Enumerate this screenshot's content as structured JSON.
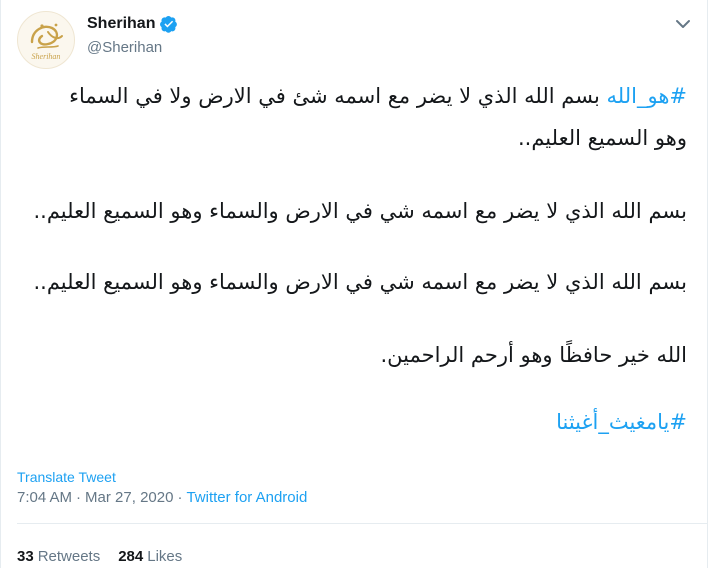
{
  "author": {
    "display_name": "Sherihan",
    "handle": "@Sherihan",
    "avatar_icon": "sherihan-calligraphy-logo",
    "avatar_logo_text": "Sherihan",
    "verified_icon": "verified-badge-icon"
  },
  "menu_icon": "chevron-down-icon",
  "tweet": {
    "hashtag1": "#هو_الله",
    "line1_text": "بسم الله الذي لا يضر مع اسمه شئ في الارض ولا في السماء",
    "line2_text": "وهو السميع العليم..",
    "line3_text": "بسم الله الذي لا يضر مع اسمه شي في الارض والسماء وهو السميع العليم..",
    "line4_text": "بسم الله الذي لا يضر مع اسمه شي في الارض والسماء وهو السميع العليم..",
    "line5_text": "الله خير حافظًا وهو أرحم الراحمين.",
    "hashtag2": "#يامغيث_أغيثنا"
  },
  "translate_label": "Translate Tweet",
  "meta": {
    "time": "7:04 AM",
    "separator1": "·",
    "date": "Mar 27, 2020",
    "separator2": "·",
    "source": "Twitter for Android"
  },
  "stats": {
    "retweets_count": "33",
    "retweets_label": "Retweets",
    "likes_count": "284",
    "likes_label": "Likes"
  },
  "colors": {
    "accent": "#1da1f2",
    "text": "#14171a",
    "muted": "#657786",
    "divider": "#e6ecf0",
    "logo_gold": "#c9a24a"
  }
}
